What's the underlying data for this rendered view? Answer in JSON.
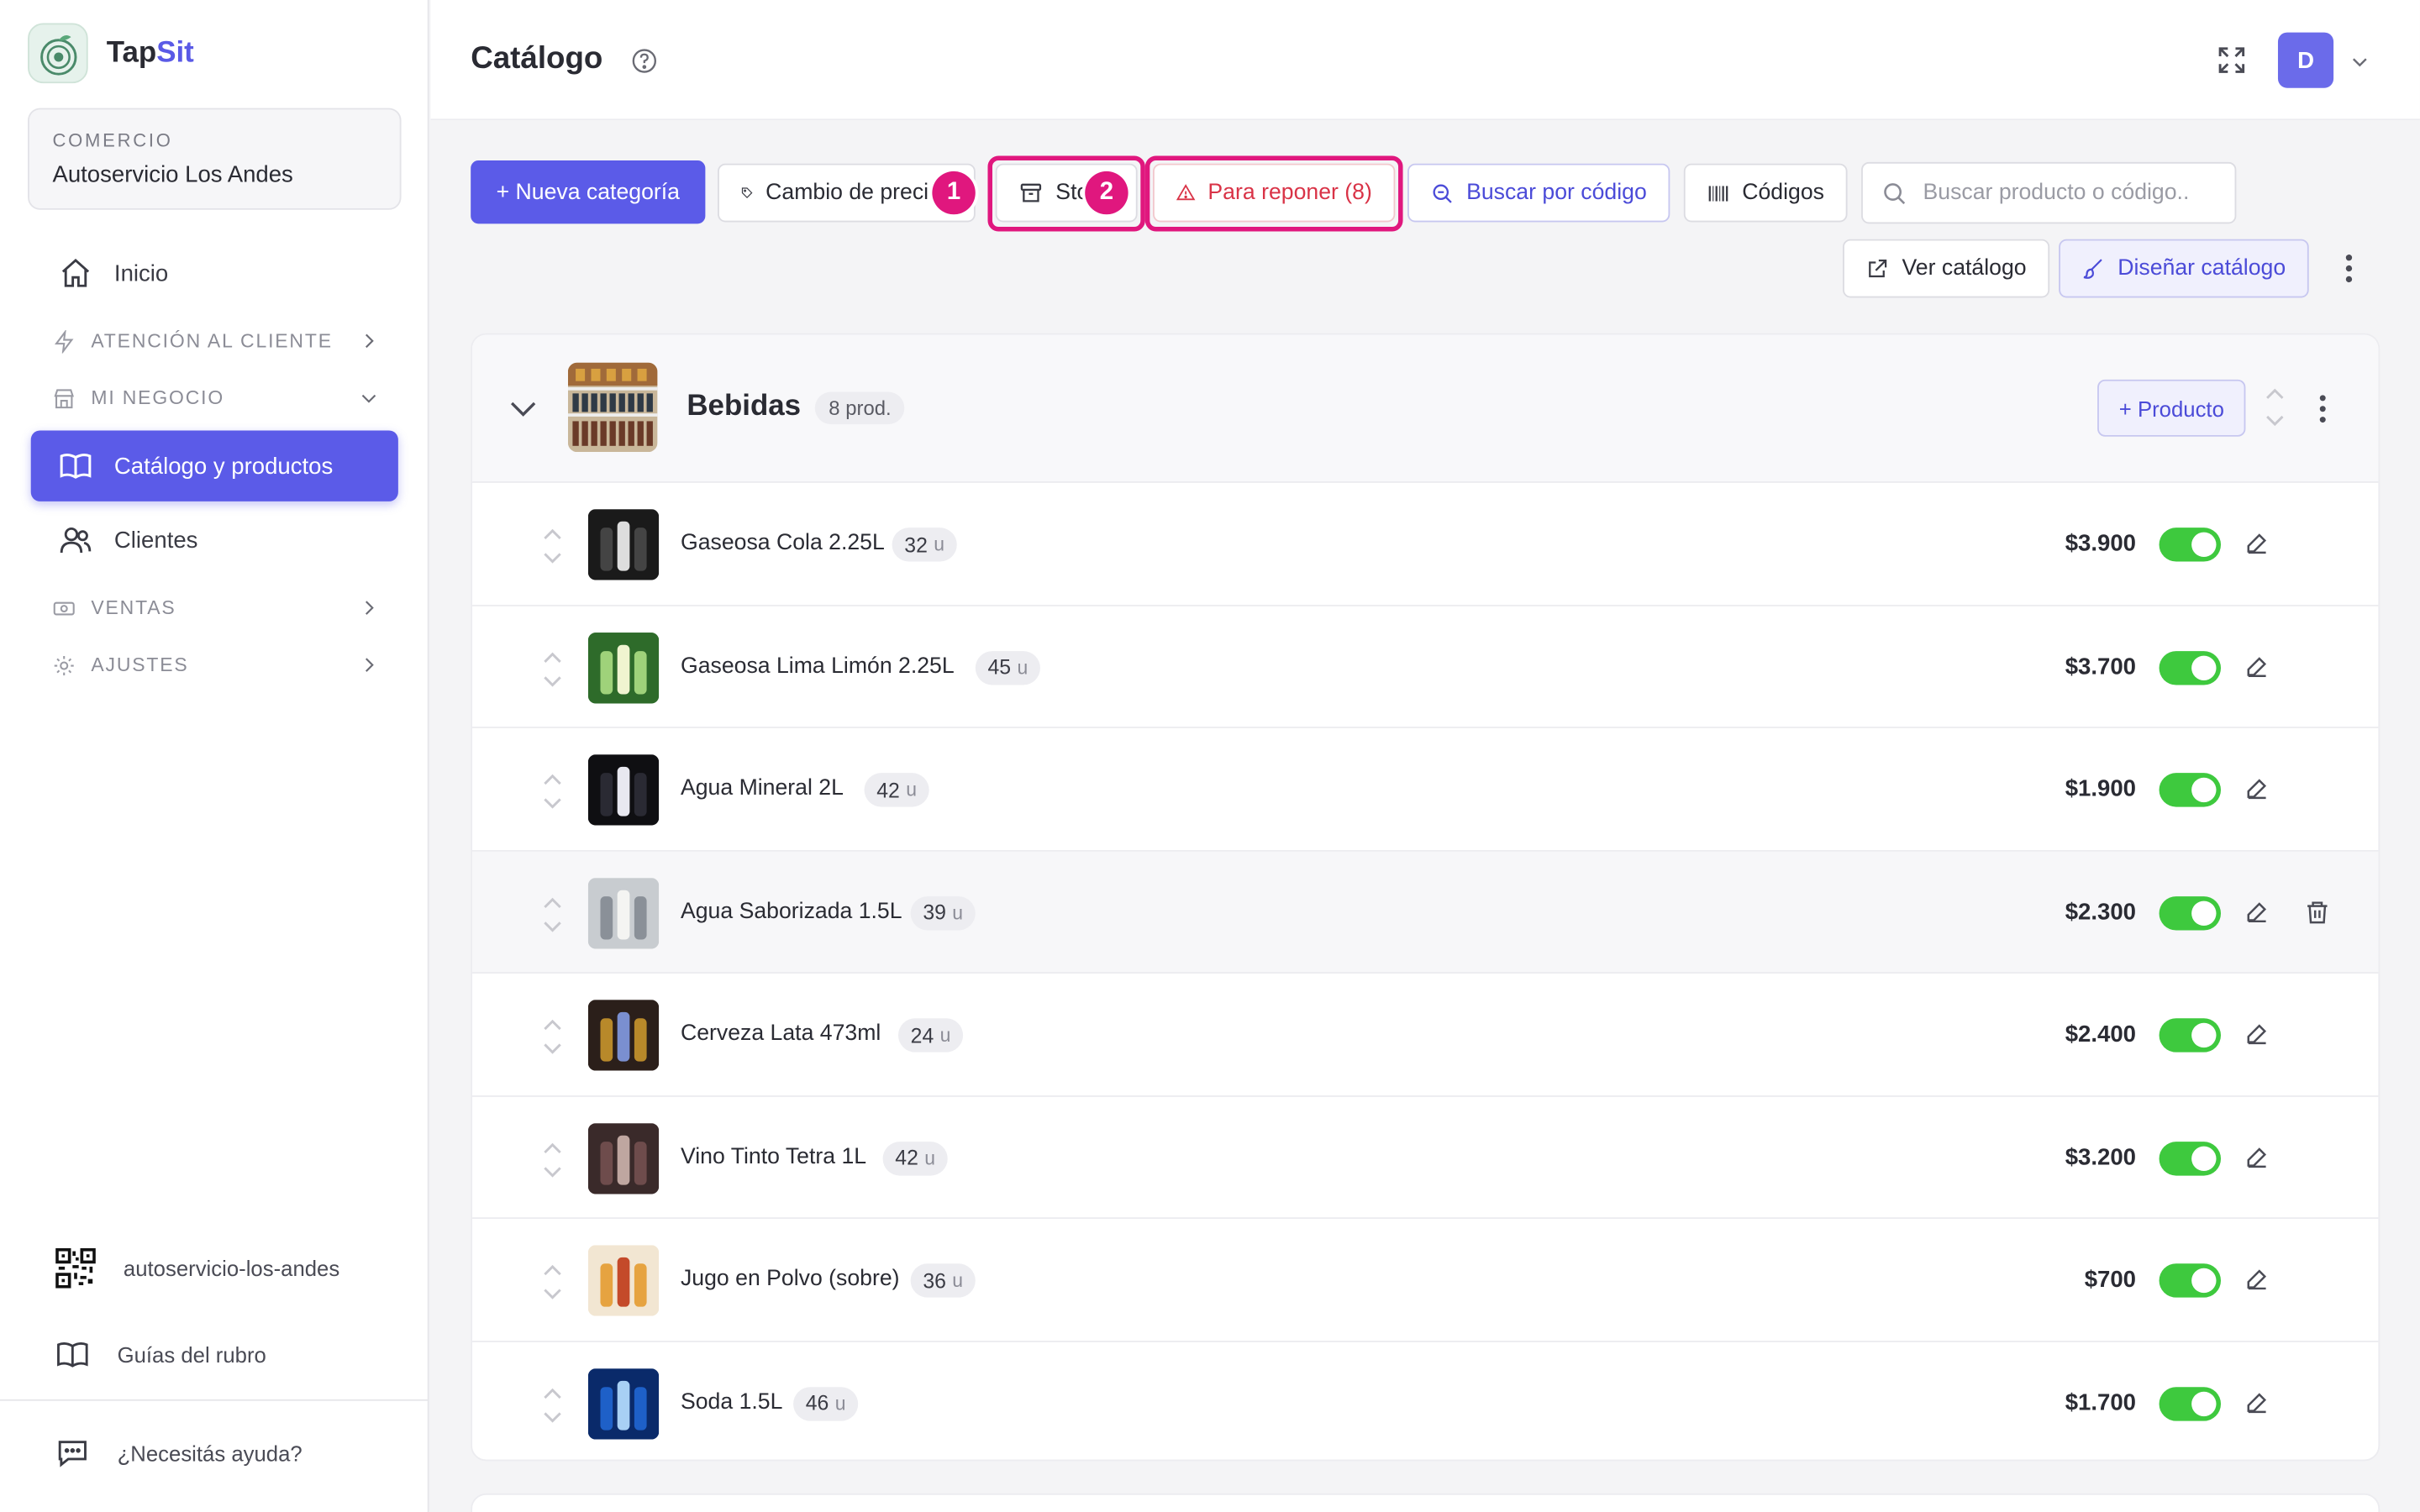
{
  "brand": {
    "name_part1": "Tap",
    "name_part2": "Sit"
  },
  "commerce": {
    "label": "COMERCIO",
    "name": "Autoservicio Los Andes"
  },
  "sidebar": {
    "home": "Inicio",
    "section_attention": "ATENCIÓN AL CLIENTE",
    "section_business": "MI NEGOCIO",
    "catalog": "Catálogo y productos",
    "clients": "Clientes",
    "section_sales": "VENTAS",
    "section_settings": "AJUSTES",
    "slug": "autoservicio-los-andes",
    "guides": "Guías del rubro",
    "help": "¿Necesitás ayuda?"
  },
  "header": {
    "title": "Catálogo",
    "avatar_initial": "D"
  },
  "toolbar": {
    "new_category": "+ Nueva categoría",
    "price_change": "Cambio de precios",
    "stock": "Stock",
    "restock": "Para reponer (8)",
    "search_by_code": "Buscar por código",
    "codes": "Códigos",
    "search_placeholder": "Buscar producto o código..",
    "view_catalog": "Ver catálogo",
    "design_catalog": "Diseñar catálogo",
    "marker_1": "1",
    "marker_2": "2"
  },
  "category": {
    "name": "Bebidas",
    "count": "8 prod.",
    "add_product": "+ Producto"
  },
  "stock_unit": "u",
  "products": [
    {
      "name": "Gaseosa Cola 2.25L",
      "stock": "32",
      "price": "$3.900",
      "active": true
    },
    {
      "name": "Gaseosa Lima Limón 2.25L",
      "stock": "45",
      "price": "$3.700",
      "active": true
    },
    {
      "name": "Agua Mineral 2L",
      "stock": "42",
      "price": "$1.900",
      "active": true
    },
    {
      "name": "Agua Saborizada 1.5L",
      "stock": "39",
      "price": "$2.300",
      "active": true
    },
    {
      "name": "Cerveza Lata 473ml",
      "stock": "24",
      "price": "$2.400",
      "active": true
    },
    {
      "name": "Vino Tinto Tetra 1L",
      "stock": "42",
      "price": "$3.200",
      "active": true
    },
    {
      "name": "Jugo en Polvo (sobre)",
      "stock": "36",
      "price": "$700",
      "active": true
    },
    {
      "name": "Soda 1.5L",
      "stock": "46",
      "price": "$1.700",
      "active": true
    }
  ],
  "colors": {
    "accent": "#5b5be8",
    "highlight": "#e0177e",
    "toggle_on": "#3ec93e",
    "danger": "#d93347"
  }
}
